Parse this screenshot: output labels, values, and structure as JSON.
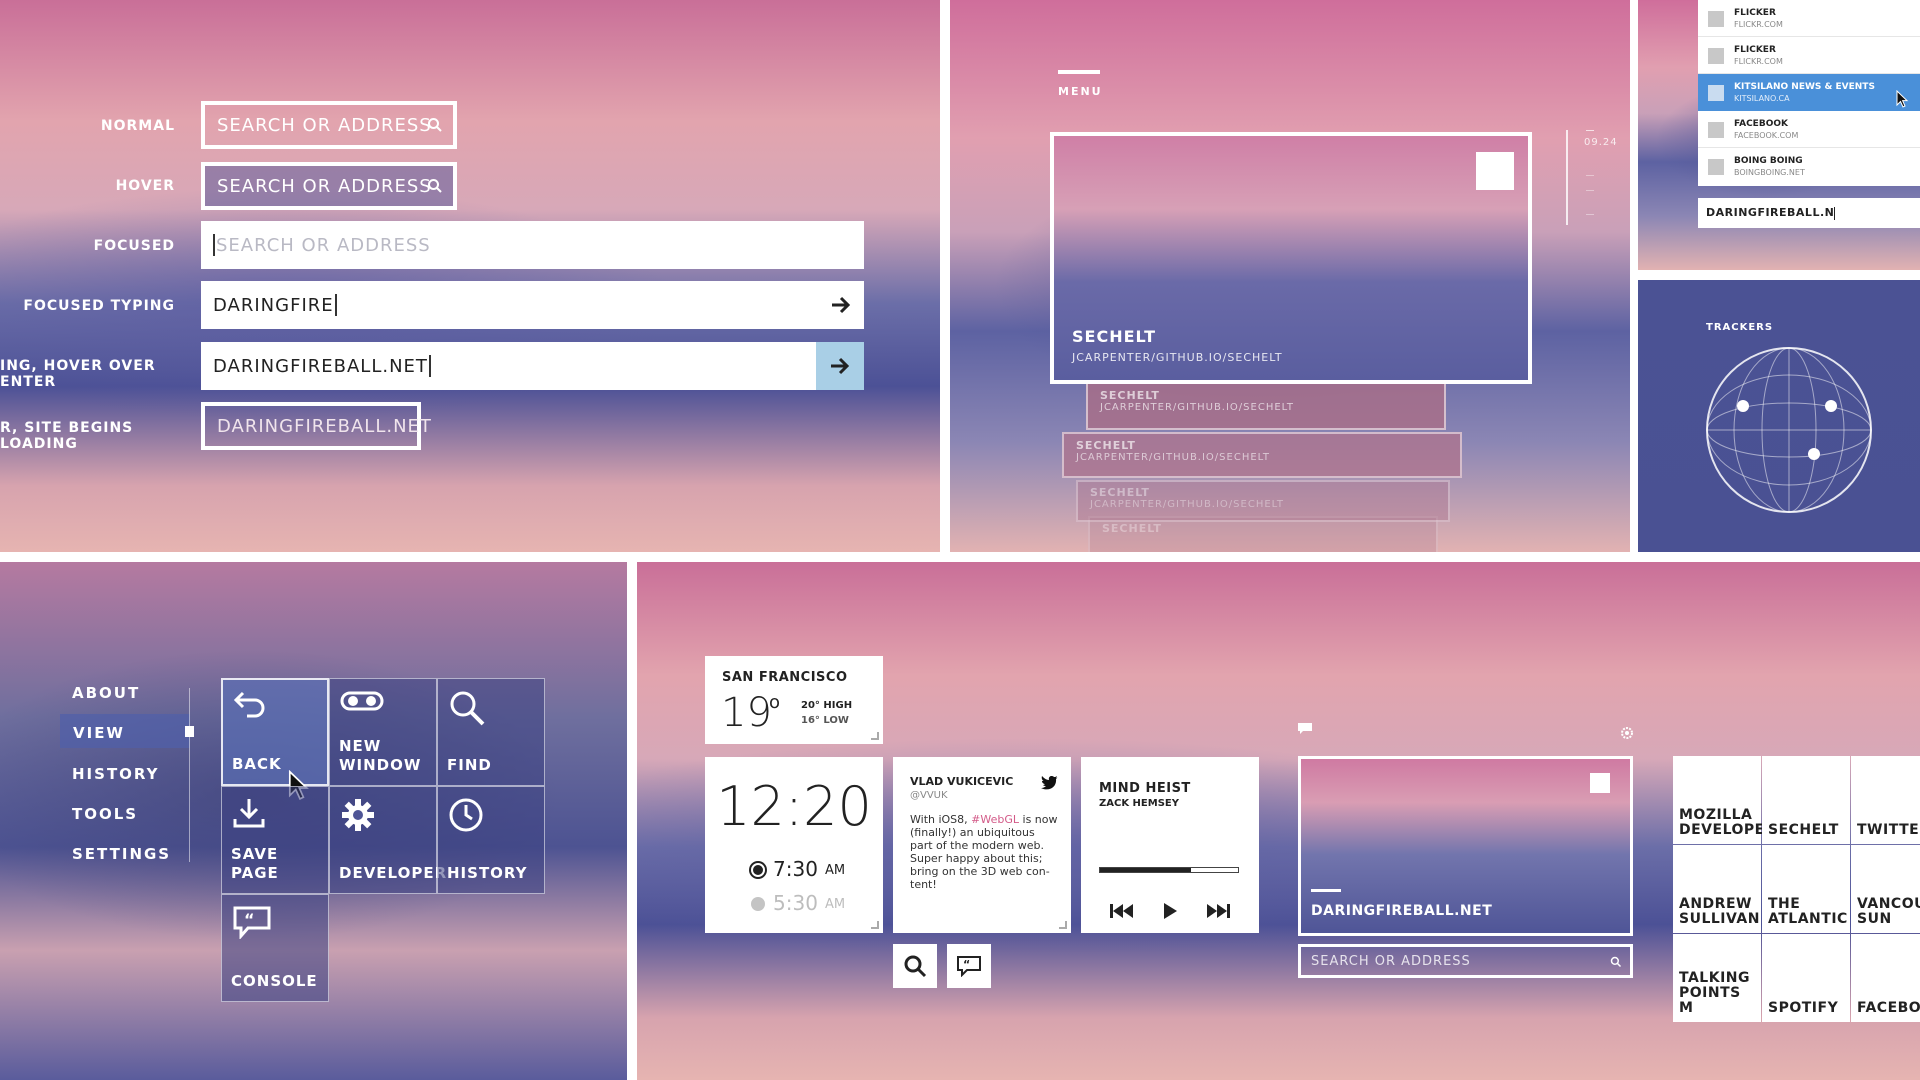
{
  "urlbar": {
    "states": [
      {
        "label": "NORMAL",
        "value": "SEARCH OR ADDRESS"
      },
      {
        "label": "HOVER",
        "value": "SEARCH OR ADDRESS"
      },
      {
        "label": "FOCUSED",
        "value": "SEARCH OR ADDRESS"
      },
      {
        "label": "FOCUSED TYPING",
        "value": "DARINGFIRE"
      },
      {
        "label": "ING, HOVER OVER ENTER",
        "value": "DARINGFIREBALL.NET"
      },
      {
        "label": "R, SITE BEGINS LOADING",
        "value": "DARINGFIREBALL.NET"
      }
    ]
  },
  "menu_panel": {
    "menu_label": "MENU",
    "time": "09.24",
    "main_card": {
      "title": "SECHELT",
      "url": "JCARPENTER/GITHUB.IO/SECHELT"
    },
    "stack": [
      {
        "title": "SECHELT",
        "url": "JCARPENTER/GITHUB.IO/SECHELT"
      },
      {
        "title": "SECHELT",
        "url": "JCARPENTER/GITHUB.IO/SECHELT"
      },
      {
        "title": "SECHELT",
        "url": "JCARPENTER/GITHUB.IO/SECHELT"
      },
      {
        "title": "SECHELT",
        "url": ""
      }
    ]
  },
  "suggestions": {
    "items": [
      {
        "title": "FLICKER",
        "url": "FLICKR.COM"
      },
      {
        "title": "FLICKER",
        "url": "FLICKR.COM"
      },
      {
        "title": "KITSILANO NEWS & EVENTS",
        "url": "KITSILANO.CA"
      },
      {
        "title": "FACEBOOK",
        "url": "FACEBOOK.COM"
      },
      {
        "title": "BOING BOING",
        "url": "BOINGBOING.NET"
      }
    ],
    "input_value": "DARINGFIREBALL.N",
    "highlight_color": "#4a90d9"
  },
  "trackers": {
    "label": "TRACKERS"
  },
  "side_menu": {
    "items": [
      "ABOUT",
      "VIEW",
      "HISTORY",
      "TOOLS",
      "SETTINGS"
    ],
    "active": "VIEW"
  },
  "view_tiles": [
    {
      "label": "BACK",
      "icon": "back-arrow-icon"
    },
    {
      "label": "NEW WINDOW",
      "icon": "mask-icon"
    },
    {
      "label": "FIND",
      "icon": "magnifier-icon"
    },
    {
      "label": "SAVE PAGE",
      "icon": "download-icon"
    },
    {
      "label": "DEVELOPER",
      "icon": "gear-icon"
    },
    {
      "label": "HISTORY",
      "icon": "clock-icon"
    },
    {
      "label": "CONSOLE",
      "icon": "speech-quote-icon"
    }
  ],
  "weather": {
    "city": "SAN FRANCISCO",
    "temp": "19",
    "unit": "o",
    "high": "20° HIGH",
    "low": "16° LOW"
  },
  "clock": {
    "time": "12:20",
    "alarm1": "7:30",
    "alarm1_suffix": "AM",
    "alarm2": "5:30",
    "alarm2_suffix": "AM"
  },
  "tweet": {
    "name": "VLAD VUKICEVIC",
    "handle": "@VVUK",
    "text_1": "With iOS8, ",
    "hashtag": "#WebGL",
    "text_2": " is now (finally!) an ubiquitous part of the modern web. Super happy about this; bring on the 3D web con-tent!"
  },
  "music": {
    "title": "MIND HEIST",
    "artist": "ZACK HEMSEY",
    "progress": 0.66
  },
  "preview": {
    "site": "DARINGFIREBALL.NET",
    "search_placeholder": "SEARCH OR ADDRESS"
  },
  "topsites": [
    [
      "MOZILLA DEVELOPE",
      "SECHELT",
      "TWITTER"
    ],
    [
      "ANDREW SULLIVAN",
      "THE ATLANTIC",
      "VANCOU SUN"
    ],
    [
      "TALKING POINTS M",
      "SPOTIFY",
      "FACEBOO"
    ]
  ]
}
